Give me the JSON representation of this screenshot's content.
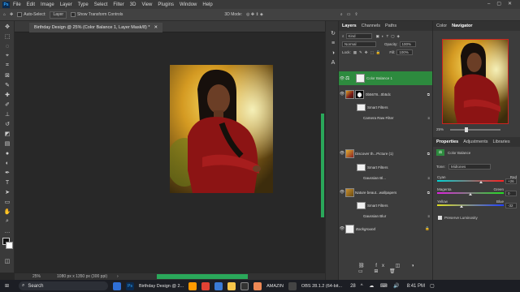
{
  "app": {
    "logo": "Ps"
  },
  "menubar": {
    "items": [
      "File",
      "Edit",
      "Image",
      "Layer",
      "Type",
      "Select",
      "Filter",
      "3D",
      "View",
      "Plugins",
      "Window",
      "Help"
    ]
  },
  "options": {
    "auto_select": "Auto-Select:",
    "layer_select": "Layer",
    "show_transform": "Show Transform Controls",
    "mode_3d": "3D Mode:"
  },
  "document": {
    "tab_title": "Birthday Design @ 25% (Color Balance 1, Layer Mask/8) *",
    "zoom": "25%",
    "doc_size": "1080 px x 1350 px (300 ppi)"
  },
  "layers_panel": {
    "tabs": [
      "Layers",
      "Channels",
      "Paths"
    ],
    "filter_kind": "Kind",
    "blend_mode": "Normal",
    "opacity_label": "Opacity:",
    "opacity_value": "100%",
    "lock_label": "Lock:",
    "fill_label": "Fill:",
    "fill_value": "100%",
    "layers": [
      {
        "name": "Color Balance 1",
        "selected": true
      },
      {
        "name": "0b5678...0b5dc",
        "selected": false
      },
      {
        "name": "Smart Filters",
        "selected": false
      },
      {
        "name": "Camera Raw Filter",
        "selected": false
      },
      {
        "name": "Discover th...Picture (1)",
        "selected": false
      },
      {
        "name": "Smart Filters",
        "selected": false
      },
      {
        "name": "Gaussian Bl...",
        "selected": false
      },
      {
        "name": "Nature beaut...wallpapers",
        "selected": false
      },
      {
        "name": "Smart Filters",
        "selected": false
      },
      {
        "name": "Gaussian Blur",
        "selected": false
      },
      {
        "name": "Background",
        "selected": false
      }
    ]
  },
  "right_panels": {
    "tabs": [
      "Color",
      "Navigator"
    ],
    "nav_zoom": "25%",
    "prop_tabs": [
      "Properties",
      "Adjustments",
      "Libraries"
    ],
    "prop_title": "Color Balance",
    "tone_label": "Tone:",
    "tone_value": "Midtones",
    "cyan_label": "Cyan",
    "red_label": "Red",
    "cyan_red_value": "+26",
    "magenta_label": "Magenta",
    "green_label": "Green",
    "magenta_green_value": "0",
    "yellow_label": "Yellow",
    "blue_label": "Blue",
    "yellow_blue_value": "-32",
    "preserve_label": "Preserve Luminosity"
  },
  "taskbar": {
    "search": "Search",
    "active_app": "Birthday Design @ 2...",
    "other_app": "AMAZIN",
    "obs_label": "OBS 28.1.2 (64-bit...",
    "weather": "28",
    "time": "8:41 PM"
  },
  "colors": {
    "accent_green": "#2d8a3e",
    "ps_blue": "#31a8ff"
  }
}
